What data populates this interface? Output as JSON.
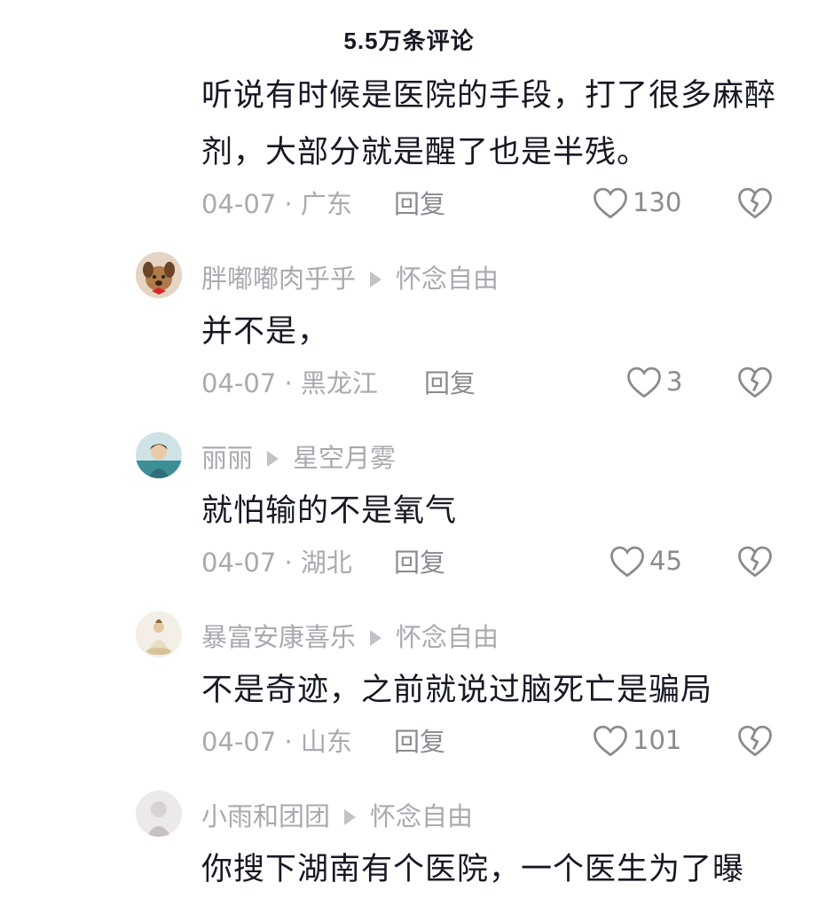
{
  "header": {
    "title": "5.5万条评论"
  },
  "comments": [
    {
      "text": "听说有时候是医院的手段，打了很多麻醉剂，大部分就是醒了也是半残。",
      "date_location": "04-07 · 广东",
      "reply_label": "回复",
      "likes": "130"
    },
    {
      "user": "胖嘟嘟肉乎乎",
      "reply_to": "怀念自由",
      "text": "并不是，",
      "date_location": "04-07 · 黑龙江",
      "reply_label": "回复",
      "likes": "3"
    },
    {
      "user": "丽丽",
      "reply_to": "星空月雾",
      "text": "就怕输的不是氧气",
      "date_location": "04-07 · 湖北",
      "reply_label": "回复",
      "likes": "45"
    },
    {
      "user": "暴富安康喜乐",
      "reply_to": "怀念自由",
      "text": "不是奇迹，之前就说过脑死亡是骗局",
      "date_location": "04-07 · 山东",
      "reply_label": "回复",
      "likes": "101"
    },
    {
      "user": "小雨和团团",
      "reply_to": "怀念自由",
      "text": "你搜下湖南有个医院，一个医生为了曝"
    }
  ],
  "colors": {
    "text": "#161823",
    "meta": "#a9aab0",
    "action": "#8a8b91"
  }
}
